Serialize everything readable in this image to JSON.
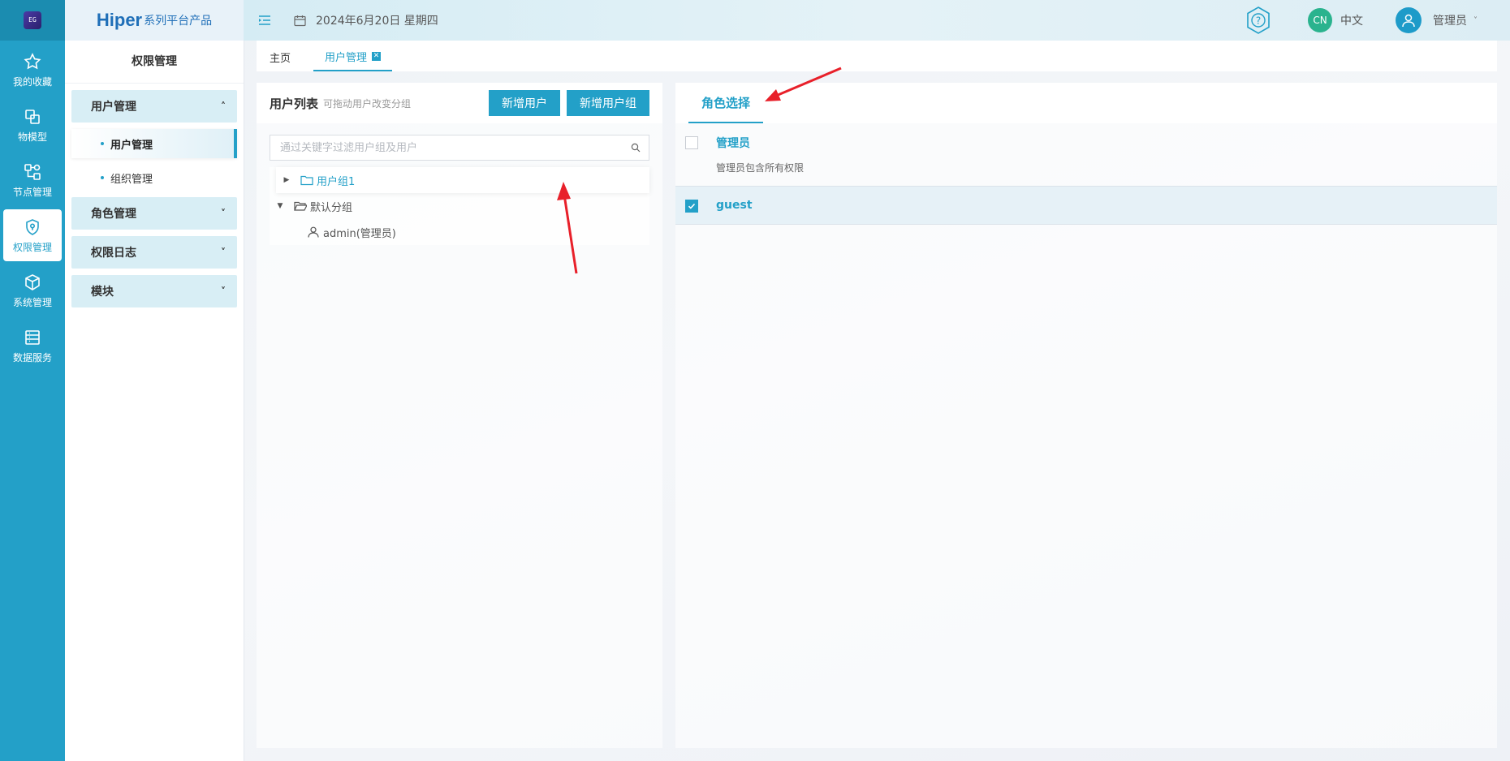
{
  "rail": {
    "logo_text": "EG",
    "items": [
      {
        "label": "我的收藏",
        "icon": "star-icon"
      },
      {
        "label": "物模型",
        "icon": "model-icon"
      },
      {
        "label": "节点管理",
        "icon": "node-icon"
      },
      {
        "label": "权限管理",
        "icon": "shield-icon"
      },
      {
        "label": "系统管理",
        "icon": "cube-icon"
      },
      {
        "label": "数据服务",
        "icon": "database-icon"
      }
    ]
  },
  "brand": {
    "name": "Hiper",
    "sub": "系列平台产品"
  },
  "sidebar": {
    "title": "权限管理",
    "groups": [
      {
        "label": "用户管理"
      },
      {
        "label": "角色管理"
      },
      {
        "label": "权限日志"
      },
      {
        "label": "模块"
      }
    ],
    "sub_items": [
      {
        "label": "用户管理"
      },
      {
        "label": "组织管理"
      }
    ]
  },
  "header": {
    "date": "2024年6月20日 星期四",
    "lang_badge": "CN",
    "lang_text": "中文",
    "user_name": "管理员"
  },
  "tabs": [
    {
      "label": "主页"
    },
    {
      "label": "用户管理"
    }
  ],
  "user_list": {
    "title": "用户列表",
    "hint": "可拖动用户改变分组",
    "btn_add_user": "新增用户",
    "btn_add_group": "新增用户组",
    "search_placeholder": "通过关键字过滤用户组及用户",
    "tree": [
      {
        "label": "用户组1"
      },
      {
        "label": "默认分组"
      },
      {
        "label": "admin(管理员)"
      }
    ]
  },
  "role_panel": {
    "tab": "角色选择",
    "roles": [
      {
        "name": "管理员",
        "desc": "管理员包含所有权限",
        "checked": false
      },
      {
        "name": "guest",
        "desc": "",
        "checked": true
      }
    ]
  },
  "colors": {
    "primary": "#23a0c8",
    "annotation": "#e8202a"
  }
}
